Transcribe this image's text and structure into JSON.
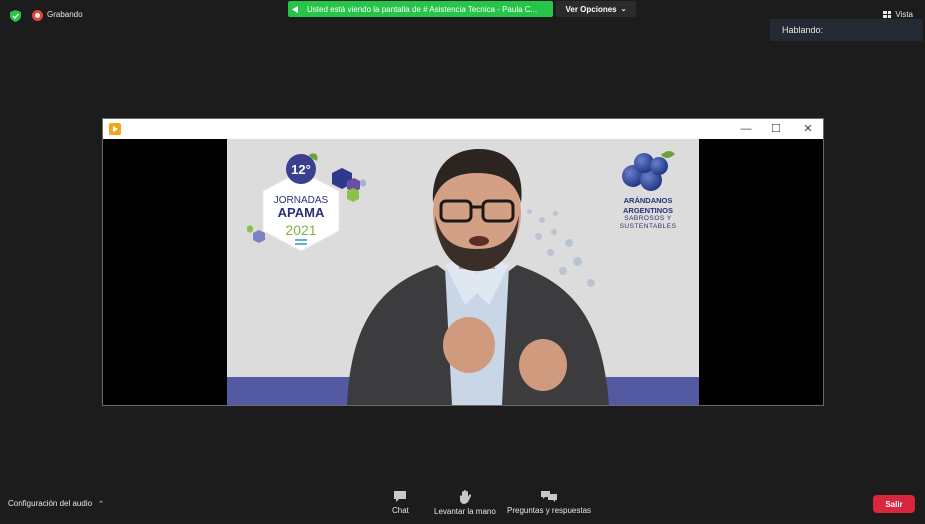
{
  "top_bar": {
    "security_icon": "shield-check-icon",
    "recording_label": "Grabando",
    "share_banner_text": "Usted está viendo la pantalla de # Asistencia Tecnica - Paula C...",
    "view_options_label": "Ver Opciones",
    "view_label": "Vista"
  },
  "speaking_panel": {
    "label": "Hablando:"
  },
  "shared_window": {
    "app_icon": "media-player-icon",
    "controls": [
      "minimize-icon",
      "maximize-icon",
      "close-icon"
    ]
  },
  "slide": {
    "edition": "12°",
    "event_line1": "JORNADAS",
    "event_line2": "APAMA",
    "year": "2021",
    "brand_line1": "ARÁNDANOS",
    "brand_line2": "ARGENTINOS",
    "tagline_line1": "SABROSOS Y",
    "tagline_line2": "SUSTENTABLES"
  },
  "toolbar": {
    "audio_config_label": "Configuración del audio",
    "chat_label": "Chat",
    "raise_hand_label": "Levantar la mano",
    "qa_label": "Preguntas y respuestas",
    "leave_label": "Salir"
  },
  "colors": {
    "background": "#1c1c1c",
    "share_banner": "#27c44a",
    "leave_button": "#d7263d",
    "record": "#e8423b",
    "slide_band": "#535aa2"
  }
}
